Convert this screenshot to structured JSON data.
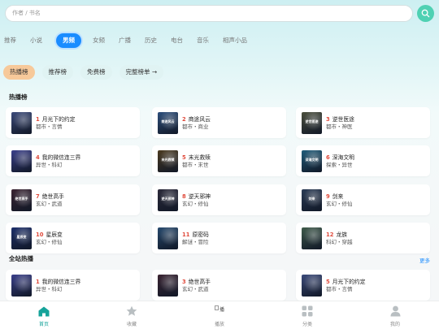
{
  "search": {
    "placeholder": "作者 / 书名"
  },
  "categories": [
    "推荐",
    "小说",
    "男频",
    "女频",
    "广播",
    "历史",
    "电台",
    "音乐",
    "相声小品"
  ],
  "active_category": "男频",
  "rank_tabs": [
    "热播榜",
    "推荐榜",
    "免费榜",
    "完整榜单 →"
  ],
  "sections": {
    "hot_title": "热播榜",
    "site_title": "全站热播",
    "more_label": "更多"
  },
  "hot_list": [
    {
      "rank": "1",
      "title": "月光下的约定",
      "tags": "都市・言情",
      "cover_color": "#3b4a7a",
      "cover_text": ""
    },
    {
      "rank": "2",
      "title": "商途风云",
      "tags": "都市・商业",
      "cover_color": "#2d4f7c",
      "cover_text": "商途风云"
    },
    {
      "rank": "3",
      "title": "逆世医途",
      "tags": "都市・神医",
      "cover_color": "#4a4e3c",
      "cover_text": "逆世医途"
    },
    {
      "rank": "4",
      "title": "我的微信连三界",
      "tags": "异世・科幻",
      "cover_color": "#3a3f8a",
      "cover_text": ""
    },
    {
      "rank": "5",
      "title": "末光救赎",
      "tags": "都市・末世",
      "cover_color": "#4b3a20",
      "cover_text": "末光救赎"
    },
    {
      "rank": "6",
      "title": "深海文明",
      "tags": "探索・异世",
      "cover_color": "#1f5c7a",
      "cover_text": "深海文明"
    },
    {
      "rank": "7",
      "title": "绝世高手",
      "tags": "玄幻・武道",
      "cover_color": "#3a2432",
      "cover_text": "绝世高手"
    },
    {
      "rank": "8",
      "title": "逆天邪神",
      "tags": "玄幻・修仙",
      "cover_color": "#2b2a3a",
      "cover_text": "逆天邪神"
    },
    {
      "rank": "9",
      "title": "剑来",
      "tags": "玄幻・修仙",
      "cover_color": "#2a3b55",
      "cover_text": "剑来"
    },
    {
      "rank": "10",
      "title": "星辰变",
      "tags": "玄幻・修仙",
      "cover_color": "#1c2f6a",
      "cover_text": "星辰变"
    },
    {
      "rank": "11",
      "title": "原密码",
      "tags": "解谜・冒险",
      "cover_color": "#274a6e",
      "cover_text": ""
    },
    {
      "rank": "12",
      "title": "龙族",
      "tags": "科幻・穿越",
      "cover_color": "#3e5a4a",
      "cover_text": ""
    }
  ],
  "site_list": [
    {
      "rank": "1",
      "title": "我的微信连三界",
      "tags": "异世・科幻",
      "cover_color": "#3a3f8a",
      "cover_text": ""
    },
    {
      "rank": "3",
      "title": "绝世高手",
      "tags": "玄幻・武道",
      "cover_color": "#3a2432",
      "cover_text": ""
    },
    {
      "rank": "5",
      "title": "月光下的约定",
      "tags": "都市・言情",
      "cover_color": "#3b4a7a",
      "cover_text": ""
    }
  ],
  "bottom_nav": [
    {
      "label": "首页",
      "icon": "home-icon",
      "active": true
    },
    {
      "label": "收藏",
      "icon": "star-icon",
      "active": false
    },
    {
      "label": "播放",
      "icon": "broken-image-icon",
      "active": false,
      "alt": "播"
    },
    {
      "label": "分类",
      "icon": "grid-icon",
      "active": false
    },
    {
      "label": "我的",
      "icon": "user-icon",
      "active": false
    }
  ],
  "colors": {
    "accent": "#1a8cff",
    "search_button": "#4fd1b3",
    "rank_number": "#e04b3c",
    "active_rank_tab": "#f7c99a",
    "nav_active": "#16a39a"
  }
}
